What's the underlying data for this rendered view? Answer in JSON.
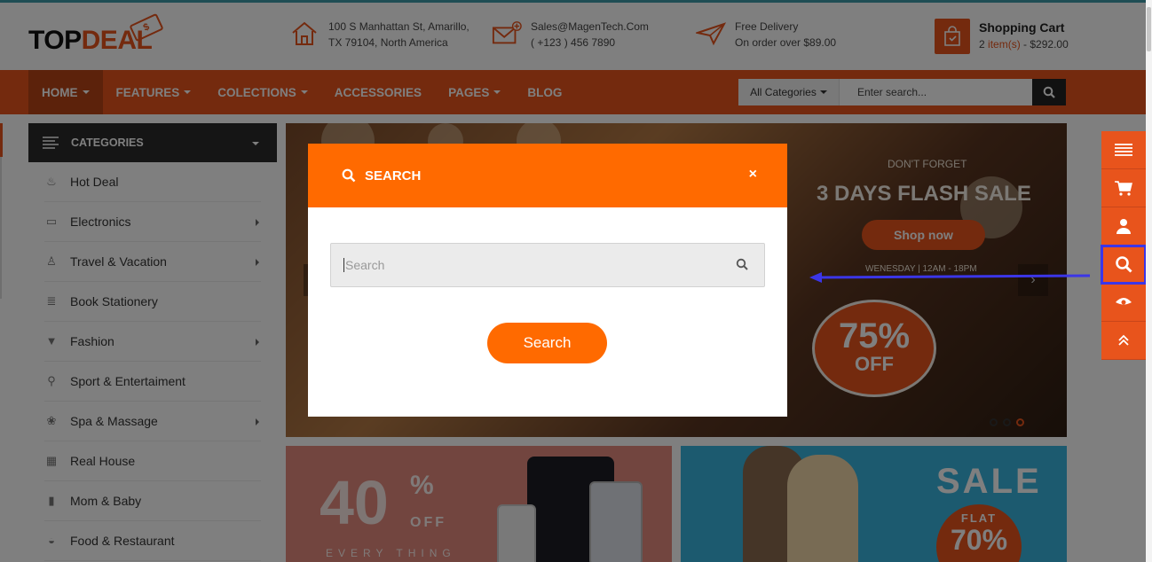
{
  "header": {
    "logo_top": "TOP",
    "logo_deal": "DEAL",
    "logo_tag": "$",
    "address_line1": "100 S Manhattan St, Amarillo,",
    "address_line2": "TX 79104, North America",
    "email": "Sales@MagenTech.Com",
    "phone": "( +123 ) 456 7890",
    "delivery_line1": "Free Delivery",
    "delivery_line2": "On order over $89.00",
    "cart_title": "Shopping Cart",
    "cart_count": "2",
    "cart_items_label": "item(s)",
    "cart_total": "- $292.00"
  },
  "nav": {
    "items": [
      {
        "label": "HOME",
        "dropdown": true,
        "active": true
      },
      {
        "label": "FEATURES",
        "dropdown": true
      },
      {
        "label": "COLECTIONS",
        "dropdown": true
      },
      {
        "label": "ACCESSORIES",
        "dropdown": false
      },
      {
        "label": "PAGES",
        "dropdown": true
      },
      {
        "label": "BLOG",
        "dropdown": false
      }
    ],
    "category_select": "All Categories",
    "search_placeholder": "Enter search..."
  },
  "categories": {
    "title": "CATEGORIES",
    "items": [
      {
        "label": "Hot Deal",
        "icon": "flame-icon",
        "submenu": false
      },
      {
        "label": "Electronics",
        "icon": "laptop-icon",
        "submenu": true
      },
      {
        "label": "Travel & Vacation",
        "icon": "walker-icon",
        "submenu": true
      },
      {
        "label": "Book Stationery",
        "icon": "books-icon",
        "submenu": false
      },
      {
        "label": "Fashion",
        "icon": "shirt-icon",
        "submenu": true
      },
      {
        "label": "Sport & Entertaiment",
        "icon": "sport-icon",
        "submenu": false
      },
      {
        "label": "Spa & Massage",
        "icon": "lotus-icon",
        "submenu": true
      },
      {
        "label": "Real House",
        "icon": "house-icon",
        "submenu": false
      },
      {
        "label": "Mom & Baby",
        "icon": "bottle-icon",
        "submenu": false
      },
      {
        "label": "Food & Restaurant",
        "icon": "food-icon",
        "submenu": false
      }
    ]
  },
  "banner": {
    "kicker": "DON'T FORGET",
    "headline": "3 DAYS FLASH SALE",
    "cta": "Shop now",
    "schedule": "WENESDAY  |  12AM - 18PM",
    "badge_pct": "75%",
    "badge_off": "OFF"
  },
  "promo1": {
    "big": "40",
    "pct": "%",
    "off": "OFF",
    "every": "EVERY THING"
  },
  "promo2": {
    "sale": "SALE",
    "flat": "FLAT",
    "pct": "70%"
  },
  "modal": {
    "title": "SEARCH",
    "close": "×",
    "placeholder": "Search",
    "button": "Search"
  },
  "right_bar": [
    "menu-icon",
    "cart-icon",
    "user-icon",
    "search-icon",
    "eye-icon",
    "chevrons-up-icon"
  ],
  "colors": {
    "brand_orange": "#e8541c",
    "modal_orange": "#ff6a00",
    "highlight_blue": "#3b36e8"
  }
}
